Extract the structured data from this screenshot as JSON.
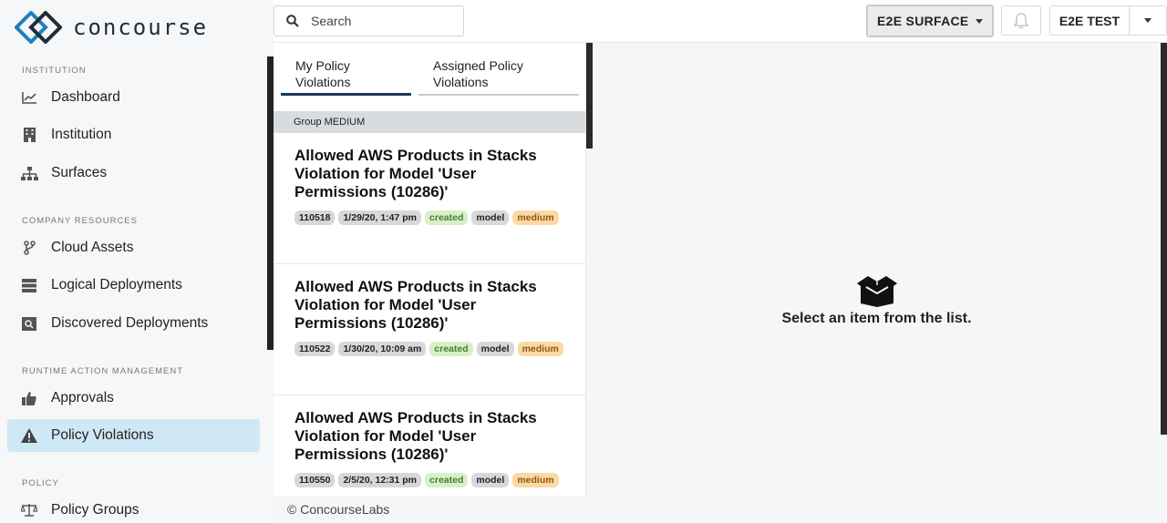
{
  "app": {
    "name": "concourse"
  },
  "sidebar": {
    "sections": [
      {
        "title": "INSTITUTION"
      },
      {
        "title": "COMPANY RESOURCES"
      },
      {
        "title": "RUNTIME ACTION MANAGEMENT"
      },
      {
        "title": "POLICY"
      }
    ],
    "items": [
      {
        "label": "Dashboard",
        "icon": "chart-line-icon"
      },
      {
        "label": "Institution",
        "icon": "building-icon"
      },
      {
        "label": "Surfaces",
        "icon": "sitemap-icon"
      },
      {
        "label": "Cloud Assets",
        "icon": "code-branch-icon"
      },
      {
        "label": "Logical Deployments",
        "icon": "server-icon"
      },
      {
        "label": "Discovered Deployments",
        "icon": "search-server-icon"
      },
      {
        "label": "Approvals",
        "icon": "thumbs-up-icon"
      },
      {
        "label": "Policy Violations",
        "icon": "warning-icon",
        "active": true
      },
      {
        "label": "Policy Groups",
        "icon": "balance-scale-icon"
      }
    ]
  },
  "topbar": {
    "search_placeholder": "Search",
    "surface_label": "E2E SURFACE",
    "user_label": "E2E TEST"
  },
  "list": {
    "tabs": [
      {
        "label_line1": "My Policy",
        "label_line2": "Violations",
        "active": true
      },
      {
        "label_line1": "Assigned Policy",
        "label_line2": "Violations",
        "active": false
      }
    ],
    "group_header": "Group MEDIUM",
    "items": [
      {
        "title": "Allowed AWS Products in Stacks Violation for Model 'User Permissions (10286)'",
        "id": "110518",
        "date": "1/29/20, 1:47 pm",
        "status": "created",
        "type": "model",
        "severity": "medium"
      },
      {
        "title": "Allowed AWS Products in Stacks Violation for Model 'User Permissions (10286)'",
        "id": "110522",
        "date": "1/30/20, 10:09 am",
        "status": "created",
        "type": "model",
        "severity": "medium"
      },
      {
        "title": "Allowed AWS Products in Stacks Violation for Model 'User Permissions (10286)'",
        "id": "110550",
        "date": "2/5/20, 12:31 pm",
        "status": "created",
        "type": "model",
        "severity": "medium"
      }
    ]
  },
  "detail": {
    "empty_text": "Select an item from the list."
  },
  "footer": {
    "text": "© ConcourseLabs"
  },
  "colors": {
    "active_nav": "#cfe8f5",
    "tab_active": "#1a3a5c",
    "tag_green": "#d7f0c8",
    "tag_orange": "#fcd9a3"
  }
}
